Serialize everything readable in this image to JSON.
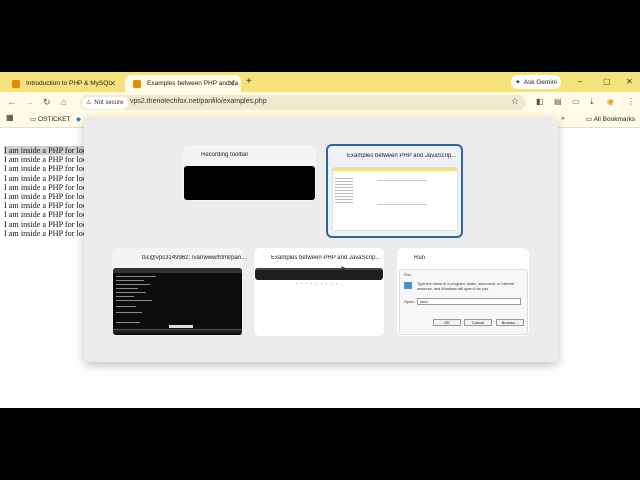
{
  "browser": {
    "tabs": [
      {
        "label": "Introduction to PHP & MySQL",
        "color": "#e68a00"
      },
      {
        "label": "Examples between PHP and Ja",
        "color": "#e68a00"
      }
    ],
    "ask_gemini": "Ask Gemini",
    "security_chip": "Not secure",
    "url": "vps2.theriotechfox.net/panfilo/examples.php",
    "bookmarks": [
      {
        "label": "OSTICKET"
      }
    ],
    "all_bookmarks": "All Bookmarks",
    "accent": "#f6e27a"
  },
  "page": {
    "lines": [
      "I am inside a PHP for loop",
      "I am inside a PHP for loop",
      "I am inside a PHP for loop",
      "I am inside a PHP for loop",
      "I am inside a PHP for loop",
      "I am inside a PHP for loop",
      "I am inside a PHP for loop",
      "I am inside a PHP for loop",
      "I am inside a PHP for loop",
      "I am inside a PHP for loop"
    ]
  },
  "switcher": {
    "windows": [
      {
        "title": "Recording toolbar"
      },
      {
        "title": "Examples between PHP and JavaScrip..."
      },
      {
        "title": "tsc@vps3149962: /var/www/html/pan..."
      },
      {
        "title": "Examples between PHP and JavaScrip..."
      },
      {
        "title": "Run"
      }
    ],
    "run_dialog": {
      "title": "Run",
      "description": "Type the name of a program, folder, document, or Internet resource, and Windows will open it for you.",
      "open_label": "Open:",
      "open_value": "cmd",
      "ok": "OK",
      "cancel": "Cancel",
      "browse": "Browse..."
    },
    "selected_border": "#2e63a6"
  }
}
